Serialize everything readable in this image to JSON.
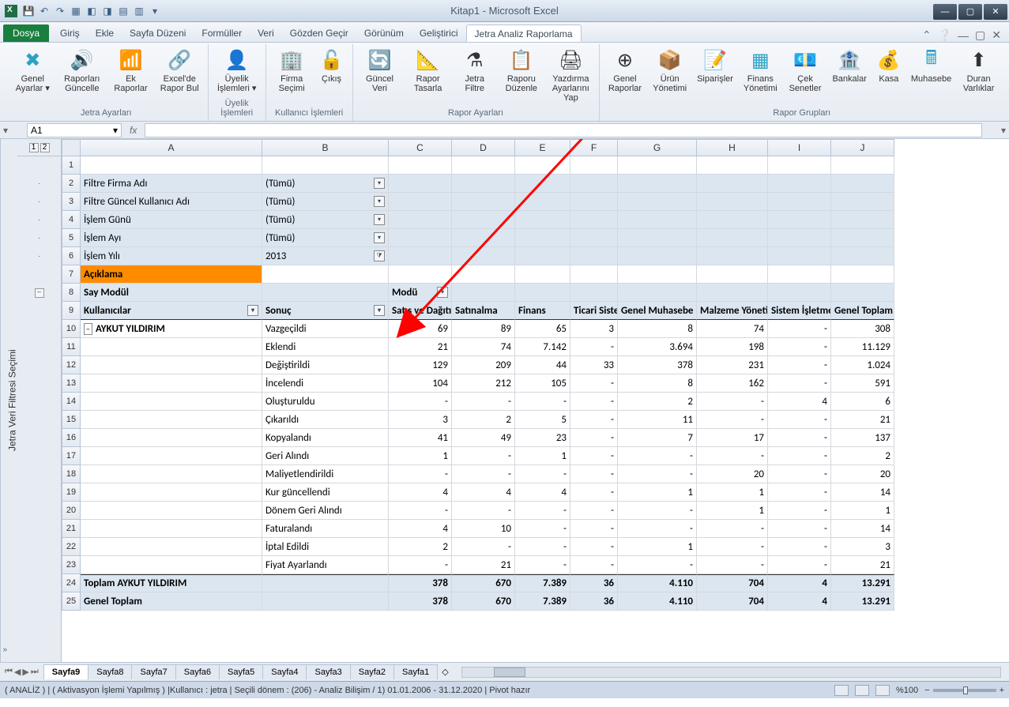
{
  "app_title": "Kitap1 - Microsoft Excel",
  "tabs": {
    "file": "Dosya",
    "giris": "Giriş",
    "ekle": "Ekle",
    "sayfa": "Sayfa Düzeni",
    "formul": "Formüller",
    "veri": "Veri",
    "gozden": "Gözden Geçir",
    "gorunum": "Görünüm",
    "gelistirici": "Geliştirici",
    "jetra": "Jetra Analiz Raporlama"
  },
  "ribbon_groups": {
    "g1": "Jetra Ayarları",
    "g2": "Üyelik İşlemleri",
    "g3": "Kullanıcı İşlemleri",
    "g4": "Rapor Ayarları",
    "g5": "Rapor Grupları"
  },
  "ribbon_btns": {
    "genel_ayarlar": "Genel Ayarlar ▾",
    "raporlari_guncelle": "Raporları Güncelle",
    "ek_raporlar": "Ek Raporlar",
    "excelde_rapor_bul": "Excel'de Rapor Bul",
    "uyelik_islemleri": "Üyelik İşlemleri ▾",
    "firma_secimi": "Firma Seçimi",
    "cikis": "Çıkış",
    "guncel_veri": "Güncel Veri",
    "rapor_tasarla": "Rapor Tasarla",
    "jetra_filtre": "Jetra Filtre",
    "raporu_duzenle": "Raporu Düzenle",
    "yazdirma": "Yazdırma Ayarlarını Yap",
    "genel_raporlar": "Genel Raporlar",
    "urun_yonetimi": "Ürün Yönetimi",
    "siparisler": "Siparişler",
    "finans_yonetimi": "Finans Yönetimi",
    "cek_senetler": "Çek Senetler",
    "bankalar": "Bankalar",
    "kasa": "Kasa",
    "muhasebe": "Muhasebe",
    "duran_varliklar": "Duran Varlıklar"
  },
  "namebox": "A1",
  "sidebar_label": "Jetra Veri Filtresi Seçimi",
  "cols": [
    "A",
    "B",
    "C",
    "D",
    "E",
    "F",
    "G",
    "H",
    "I",
    "J"
  ],
  "filters": [
    {
      "label": "Filtre Firma Adı",
      "val": "(Tümü)"
    },
    {
      "label": "Filtre Güncel Kullanıcı Adı",
      "val": "(Tümü)"
    },
    {
      "label": "İşlem Günü",
      "val": "(Tümü)"
    },
    {
      "label": "İşlem Ayı",
      "val": "(Tümü)"
    },
    {
      "label": "İşlem Yılı",
      "val": "2013"
    }
  ],
  "aciklama": "Açıklama",
  "pvt": {
    "say_modul": "Say Modül",
    "modu": "Modü",
    "kullanicilar": "Kullanıcılar",
    "sonuc": "Sonuç",
    "cols": [
      "Satış ve Dağıtım",
      "Satınalma",
      "Finans",
      "Ticari Sistem",
      "Genel Muhasebe",
      "Malzeme Yönetimi",
      "Sistem İşletmeni",
      "Genel Toplam"
    ]
  },
  "user": "AYKUT YILDIRIM",
  "rows": [
    {
      "b": "Vazgeçildi",
      "v": [
        "69",
        "89",
        "65",
        "3",
        "8",
        "74",
        "-",
        "308"
      ]
    },
    {
      "b": "Eklendi",
      "v": [
        "21",
        "74",
        "7.142",
        "-",
        "3.694",
        "198",
        "-",
        "11.129"
      ]
    },
    {
      "b": "Değiştirildi",
      "v": [
        "129",
        "209",
        "44",
        "33",
        "378",
        "231",
        "-",
        "1.024"
      ]
    },
    {
      "b": "İncelendi",
      "v": [
        "104",
        "212",
        "105",
        "-",
        "8",
        "162",
        "-",
        "591"
      ]
    },
    {
      "b": "Oluşturuldu",
      "v": [
        "-",
        "-",
        "-",
        "-",
        "2",
        "-",
        "4",
        "6"
      ]
    },
    {
      "b": "Çıkarıldı",
      "v": [
        "3",
        "2",
        "5",
        "-",
        "11",
        "-",
        "-",
        "21"
      ]
    },
    {
      "b": "Kopyalandı",
      "v": [
        "41",
        "49",
        "23",
        "-",
        "7",
        "17",
        "-",
        "137"
      ]
    },
    {
      "b": "Geri Alındı",
      "v": [
        "1",
        "-",
        "1",
        "-",
        "-",
        "-",
        "-",
        "2"
      ]
    },
    {
      "b": "Maliyetlendirildi",
      "v": [
        "-",
        "-",
        "-",
        "-",
        "-",
        "20",
        "-",
        "20"
      ]
    },
    {
      "b": "Kur güncellendi",
      "v": [
        "4",
        "4",
        "4",
        "-",
        "1",
        "1",
        "-",
        "14"
      ]
    },
    {
      "b": "Dönem Geri Alındı",
      "v": [
        "-",
        "-",
        "-",
        "-",
        "-",
        "1",
        "-",
        "1"
      ]
    },
    {
      "b": "Faturalandı",
      "v": [
        "4",
        "10",
        "-",
        "-",
        "-",
        "-",
        "-",
        "14"
      ]
    },
    {
      "b": "İptal Edildi",
      "v": [
        "2",
        "-",
        "-",
        "-",
        "1",
        "-",
        "-",
        "3"
      ]
    },
    {
      "b": "Fiyat Ayarlandı",
      "v": [
        "-",
        "21",
        "-",
        "-",
        "-",
        "-",
        "-",
        "21"
      ]
    }
  ],
  "toplam_label": "Toplam AYKUT YILDIRIM",
  "toplam": [
    "378",
    "670",
    "7.389",
    "36",
    "4.110",
    "704",
    "4",
    "13.291"
  ],
  "genel_toplam_label": "Genel Toplam",
  "genel_toplam": [
    "378",
    "670",
    "7.389",
    "36",
    "4.110",
    "704",
    "4",
    "13.291"
  ],
  "sheets": [
    "Sayfa9",
    "Sayfa8",
    "Sayfa7",
    "Sayfa6",
    "Sayfa5",
    "Sayfa4",
    "Sayfa3",
    "Sayfa2",
    "Sayfa1"
  ],
  "status_left": "( ANALİZ ) | ( Aktivasyon İşlemi Yapılmış ) |Kullanıcı : jetra | Seçili dönem : (206) - Analiz Bilişim / 1) 01.01.2006 - 31.12.2020    | Pivot hazır",
  "zoom": "%100",
  "outline": {
    "levels": [
      "1",
      "2"
    ]
  }
}
